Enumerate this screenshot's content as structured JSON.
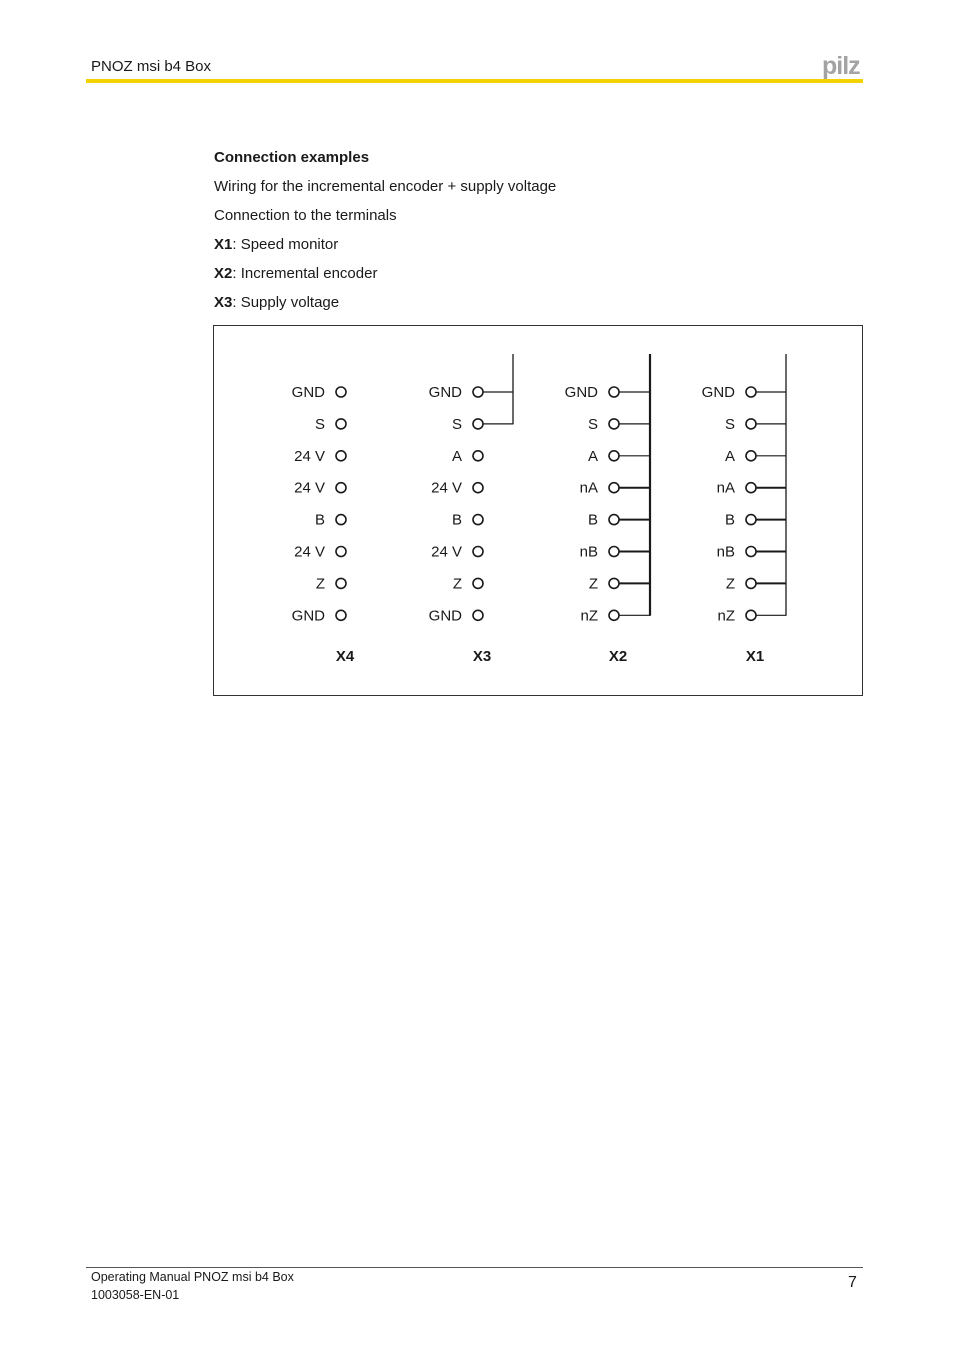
{
  "header": {
    "title": "PNOZ msi b4 Box",
    "logo": "pilz",
    "accent_color": "#f2d300"
  },
  "section": {
    "heading": "Connection examples",
    "paragraphs": [
      "Wiring for the incremental encoder + supply voltage",
      "Connection to the terminals"
    ],
    "terminal_descriptions": [
      {
        "id": "X1",
        "text": ": Speed monitor"
      },
      {
        "id": "X2",
        "text": ": Incremental encoder"
      },
      {
        "id": "X3",
        "text": ": Supply voltage"
      }
    ]
  },
  "diagram": {
    "connectors": [
      {
        "name": "X4",
        "pins": [
          "GND",
          "S",
          "24 V",
          "24 V",
          "B",
          "24 V",
          "Z",
          "GND"
        ],
        "wired_pins": [],
        "bus": "none"
      },
      {
        "name": "X3",
        "pins": [
          "GND",
          "S",
          "A",
          "24 V",
          "B",
          "24 V",
          "Z",
          "GND"
        ],
        "wired_pins": [
          0,
          1
        ],
        "bus": "thin"
      },
      {
        "name": "X2",
        "pins": [
          "GND",
          "S",
          "A",
          "nA",
          "B",
          "nB",
          "Z",
          "nZ"
        ],
        "wired_pins": [
          0,
          1,
          2,
          3,
          4,
          5,
          6,
          7
        ],
        "bus": "thick"
      },
      {
        "name": "X1",
        "pins": [
          "GND",
          "S",
          "A",
          "nA",
          "B",
          "nB",
          "Z",
          "nZ"
        ],
        "wired_pins": [
          0,
          1,
          2,
          3,
          4,
          5,
          6,
          7
        ],
        "bus": "thin"
      }
    ]
  },
  "footer": {
    "manual_title": "Operating Manual PNOZ msi b4 Box",
    "doc_number": "1003058-EN-01",
    "page_number": "7"
  }
}
